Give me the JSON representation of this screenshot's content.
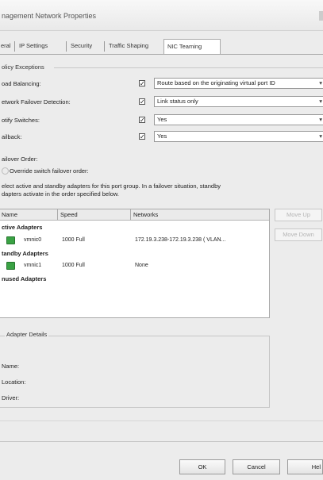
{
  "window": {
    "title": "nagement Network Properties"
  },
  "tabs": [
    {
      "label": "eral"
    },
    {
      "label": "IP Settings"
    },
    {
      "label": "Security"
    },
    {
      "label": "Traffic Shaping"
    },
    {
      "label": "NIC Teaming",
      "active": true
    }
  ],
  "policy_exceptions": {
    "group_label": "olicy Exceptions",
    "rows": [
      {
        "label": "oad Balancing:",
        "checked": "✓",
        "value": "Route based on the originating virtual port ID"
      },
      {
        "label": "etwork Failover Detection:",
        "checked": "✓",
        "value": "Link status only"
      },
      {
        "label": "otify Switches:",
        "checked": "✓",
        "value": "Yes"
      },
      {
        "label": "ailback:",
        "checked": "✓",
        "value": "Yes"
      }
    ]
  },
  "failover": {
    "label": "ailover Order:",
    "override_label": "Override switch failover order:",
    "description_line1": "elect active and standby adapters for this port group. In a failover situation, standby",
    "description_line2": "dapters activate in the order specified below."
  },
  "adapters_table": {
    "columns": [
      "Name",
      "Speed",
      "Networks"
    ],
    "sections": [
      {
        "title": "ctive Adapters",
        "rows": [
          {
            "name": "vmnic0",
            "speed": "1000 Full",
            "networks": "172.19.3.238-172.19.3.238 ( VLAN..."
          }
        ]
      },
      {
        "title": "tandby Adapters",
        "rows": [
          {
            "name": "vmnic1",
            "speed": "1000 Full",
            "networks": "None"
          }
        ]
      },
      {
        "title": "nused Adapters",
        "rows": []
      }
    ]
  },
  "side_buttons": {
    "move_up": "Move Up",
    "move_down": "Move Down"
  },
  "adapter_details": {
    "group_label": "Adapter Details",
    "fields": [
      {
        "label": "Name:"
      },
      {
        "label": "Location:"
      },
      {
        "label": "Driver:"
      }
    ]
  },
  "footer": {
    "ok": "OK",
    "cancel": "Cancel",
    "help": "Hel"
  },
  "colors": {
    "nic_icon": "#3aa244"
  }
}
